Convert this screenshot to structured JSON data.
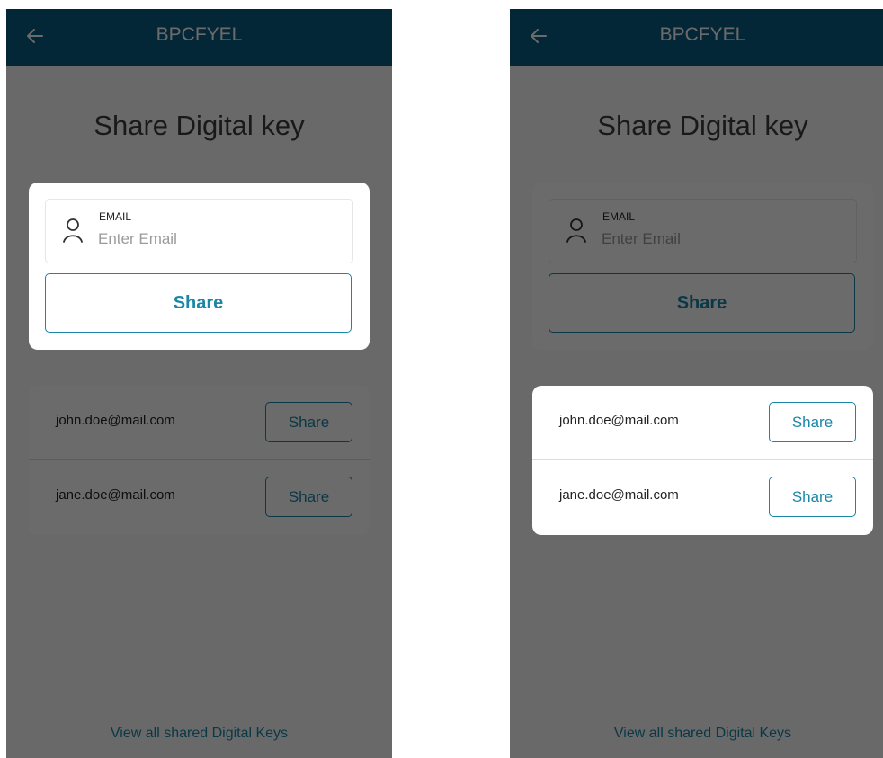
{
  "screens": [
    {
      "header": {
        "back_icon": "arrow-left-icon",
        "title": "BPCFYEL"
      },
      "page_title": "Share Digital key",
      "email_form": {
        "label": "EMAIL",
        "placeholder": "Enter Email",
        "user_icon": "user-icon",
        "share_label": "Share"
      },
      "shared_list": [
        {
          "email": "john.doe@mail.com",
          "share_label": "Share"
        },
        {
          "email": "jane.doe@mail.com",
          "share_label": "Share"
        }
      ],
      "footer_link": "View all shared Digital Keys",
      "highlighted": "email_form"
    },
    {
      "header": {
        "back_icon": "arrow-left-icon",
        "title": "BPCFYEL"
      },
      "page_title": "Share Digital key",
      "email_form": {
        "label": "EMAIL",
        "placeholder": "Enter Email",
        "user_icon": "user-icon",
        "share_label": "Share"
      },
      "shared_list": [
        {
          "email": "john.doe@mail.com",
          "share_label": "Share"
        },
        {
          "email": "jane.doe@mail.com",
          "share_label": "Share"
        }
      ],
      "footer_link": "View all shared Digital Keys",
      "highlighted": "shared_list"
    }
  ],
  "colors": {
    "header_bg": "#0b5d85",
    "accent": "#1a87a8",
    "overlay": "rgba(0,0,0,0.58)"
  }
}
